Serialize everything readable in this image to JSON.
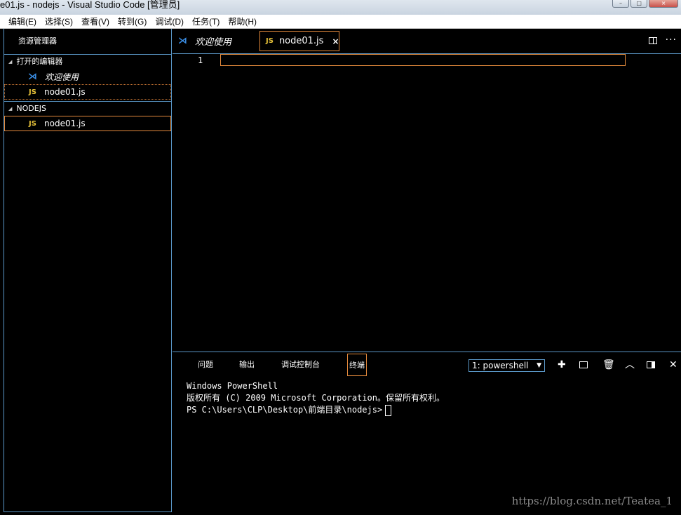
{
  "window": {
    "title": "e01.js - nodejs - Visual Studio Code [管理员]"
  },
  "menu": [
    "编辑(E)",
    "选择(S)",
    "查看(V)",
    "转到(G)",
    "调试(D)",
    "任务(T)",
    "帮助(H)"
  ],
  "sidebar": {
    "header": "资源管理器",
    "open_editors_label": "打开的编辑器",
    "open_editors": [
      {
        "icon": "vscode-icon",
        "label": "欢迎使用"
      },
      {
        "icon": "js-icon",
        "label": "node01.js"
      }
    ],
    "folder_label": "NODEJS",
    "files": [
      {
        "icon": "js-icon",
        "label": "node01.js"
      }
    ],
    "js_badge": "JS"
  },
  "tabs": {
    "welcome": "欢迎使用",
    "active": "node01.js",
    "close": "×"
  },
  "editor": {
    "line_number": "1"
  },
  "panel": {
    "tabs": [
      "问题",
      "输出",
      "调试控制台",
      "终端"
    ],
    "active_tab": "终端",
    "terminal_select": "1: powershell",
    "terminal_lines": [
      "Windows PowerShell",
      "版权所有 (C) 2009 Microsoft Corporation。保留所有权利。",
      "",
      "PS C:\\Users\\CLP\\Desktop\\前端目录\\nodejs>"
    ]
  },
  "watermark": "https://blog.csdn.net/Teatea_1",
  "colors": {
    "accent_border": "#e48a3c",
    "divider": "#5a97c7",
    "js_badge": "#e8c33a"
  }
}
